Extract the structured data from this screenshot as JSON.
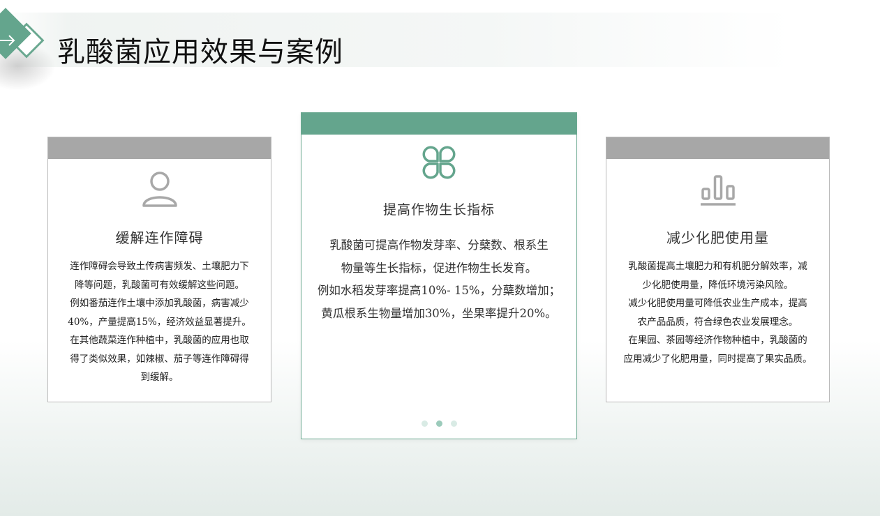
{
  "title": "乳酸菌应用效果与案例",
  "colors": {
    "accent": "#64a58d",
    "side_header": "#a7a7a7",
    "icon_gray": "#a8a8a8"
  },
  "cards": [
    {
      "title": "缓解连作障碍",
      "icon": "user-icon",
      "lines": [
        "连作障碍会导致土传病害频发、土壤肥力下",
        "降等问题，乳酸菌可有效缓解这些问题。",
        "例如番茄连作土壤中添加乳酸菌，病害减少",
        "40%，产量提高15%，经济效益显著提升。",
        "在其他蔬菜连作种植中，乳酸菌的应用也取",
        "得了类似效果，如辣椒、茄子等连作障碍得",
        "到缓解。"
      ]
    },
    {
      "title": "提高作物生长指标",
      "icon": "clover-icon",
      "lines": [
        "乳酸菌可提高作物发芽率、分蘖数、根系生",
        "物量等生长指标，促进作物生长发育。",
        "例如水稻发芽率提高10%- 15%，分蘖数增加；",
        "黄瓜根系生物量增加30%，坐果率提升20%。"
      ]
    },
    {
      "title": "减少化肥使用量",
      "icon": "bar-chart-icon",
      "lines": [
        "乳酸菌提高土壤肥力和有机肥分解效率，减",
        "少化肥使用量，降低环境污染风险。",
        "减少化肥使用量可降低农业生产成本，提高",
        "农产品品质，符合绿色农业发展理念。",
        "在果园、茶园等经济作物种植中，乳酸菌的",
        "应用减少了化肥用量，同时提高了果实品质。"
      ]
    }
  ],
  "carousel": {
    "count": 3,
    "active": 2
  }
}
